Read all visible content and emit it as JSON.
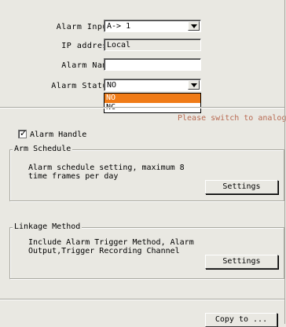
{
  "form": {
    "alarm_input_label": "Alarm Input:",
    "alarm_input_value": "A-> 1",
    "ip_address_label": "IP address:",
    "ip_address_value": "Local",
    "alarm_name_label": "Alarm Name:",
    "alarm_name_value": "",
    "alarm_status_label": "Alarm Status:",
    "alarm_status_value": "NO",
    "alarm_status_options": [
      "NO",
      "NC"
    ]
  },
  "warning": "Please switch to analog",
  "alarm_handle": {
    "label": "Alarm Handle",
    "checked": true
  },
  "arm_schedule": {
    "title": "Arm Schedule",
    "description": "Alarm schedule setting, maximum 8\ntime frames per day",
    "button": "Settings"
  },
  "linkage": {
    "title": "Linkage Method",
    "description": "Include Alarm Trigger Method, Alarm\nOutput,Trigger Recording Channel",
    "button": "Settings"
  },
  "copy_button": "Copy to ...",
  "colors": {
    "background": "#e9e8e2",
    "highlight": "#f07b16",
    "warning": "#b86a52"
  },
  "icons": [
    "dropdown-arrow-icon",
    "checkmark-icon"
  ]
}
